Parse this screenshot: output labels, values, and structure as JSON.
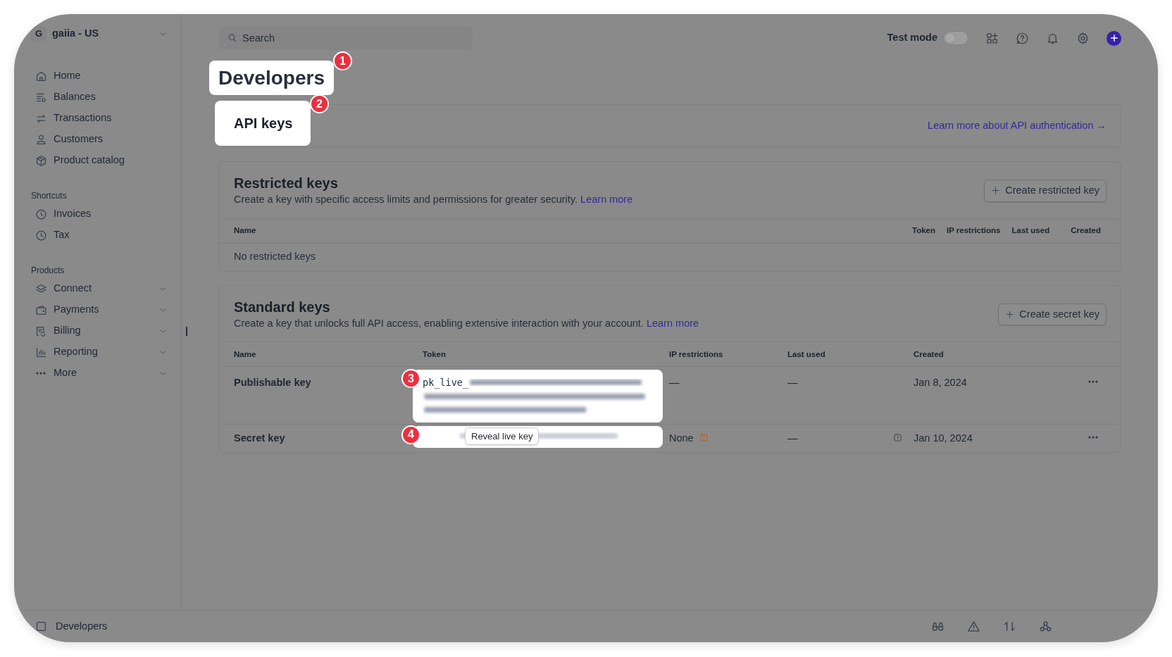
{
  "account": {
    "initial": "G",
    "name": "gaiia - US"
  },
  "nav": [
    {
      "label": "Home"
    },
    {
      "label": "Balances"
    },
    {
      "label": "Transactions"
    },
    {
      "label": "Customers"
    },
    {
      "label": "Product catalog"
    }
  ],
  "shortcuts": {
    "title": "Shortcuts",
    "items": [
      {
        "label": "Invoices"
      },
      {
        "label": "Tax"
      }
    ]
  },
  "products": {
    "title": "Products",
    "items": [
      {
        "label": "Connect",
        "expanded": false
      },
      {
        "label": "Payments",
        "expanded": false
      },
      {
        "label": "Billing",
        "expanded": false
      },
      {
        "label": "Reporting",
        "expanded": false
      },
      {
        "label": "More",
        "expanded": false
      }
    ]
  },
  "search": {
    "placeholder": "Search"
  },
  "test_mode": {
    "label": "Test mode",
    "on": false
  },
  "page_title": {
    "text": "Developers",
    "badge": "1"
  },
  "api_section": {
    "tab": "API keys",
    "badge": "2",
    "link": "Learn more about API authentication →"
  },
  "restricted": {
    "title": "Restricted keys",
    "description": "Create a key with specific access limits and permissions for greater security.",
    "learn_more": "Learn more",
    "button": "Create restricted key",
    "columns": [
      "Name",
      "Token",
      "IP restrictions",
      "Last used",
      "Created"
    ],
    "empty": "No restricted keys"
  },
  "standard": {
    "title": "Standard keys",
    "description": "Create a key that unlocks full API access, enabling extensive interaction with your account.",
    "learn_more": "Learn more",
    "button": "Create secret key",
    "columns": [
      "Name",
      "Token",
      "IP restrictions",
      "Last used",
      "Created"
    ],
    "rows": [
      {
        "kind": "publishable",
        "name": "Publishable key",
        "token": "pk_live_",
        "badge": "3",
        "ip": "—",
        "ip_warning": false,
        "last_used": "—",
        "note": false,
        "created": "Jan 8, 2024"
      },
      {
        "kind": "secret",
        "name": "Secret key",
        "reveal": "Reveal live key",
        "badge": "4",
        "ip": "None",
        "ip_warning": true,
        "last_used": "—",
        "note": true,
        "created": "Jan 10, 2024"
      }
    ]
  },
  "footer": {
    "label": "Developers"
  }
}
